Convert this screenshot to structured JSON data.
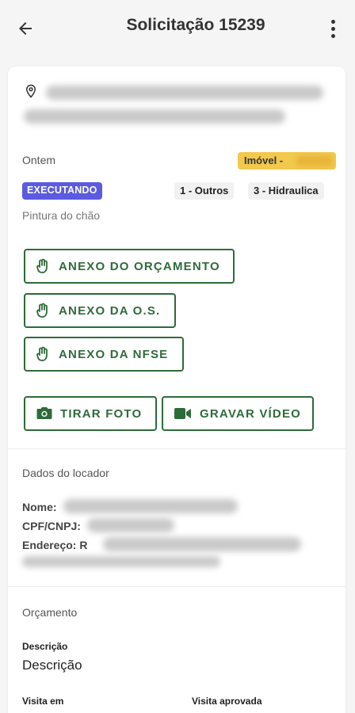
{
  "header": {
    "title": "Solicitação 15239"
  },
  "request": {
    "date_label": "Ontem",
    "imovel_label": "Imóvel -",
    "status": "EXECUTANDO",
    "tags": [
      "1 - Outros",
      "3 - Hidraulica"
    ],
    "description": "Pintura do chão"
  },
  "actions": {
    "anexo_orcamento": "ANEXO DO ORÇAMENTO",
    "anexo_os": "ANEXO DA O.S.",
    "anexo_nfse": "ANEXO DA NFSE",
    "tirar_foto": "TIRAR FOTO",
    "gravar_video": "GRAVAR VÍDEO"
  },
  "locador": {
    "section_title": "Dados do locador",
    "nome_label": "Nome:",
    "cpf_label": "CPF/CNPJ:",
    "endereco_label": "Endereço: R"
  },
  "orcamento": {
    "section_title": "Orçamento",
    "descricao_label": "Descrição",
    "descricao_value": "Descrição",
    "visita_em_label": "Visita em",
    "visita_aprovada_label": "Visita aprovada"
  },
  "colors": {
    "accent": "#2e6b3a",
    "status": "#5b5be0",
    "imovel_badge": "#f2c94c"
  }
}
